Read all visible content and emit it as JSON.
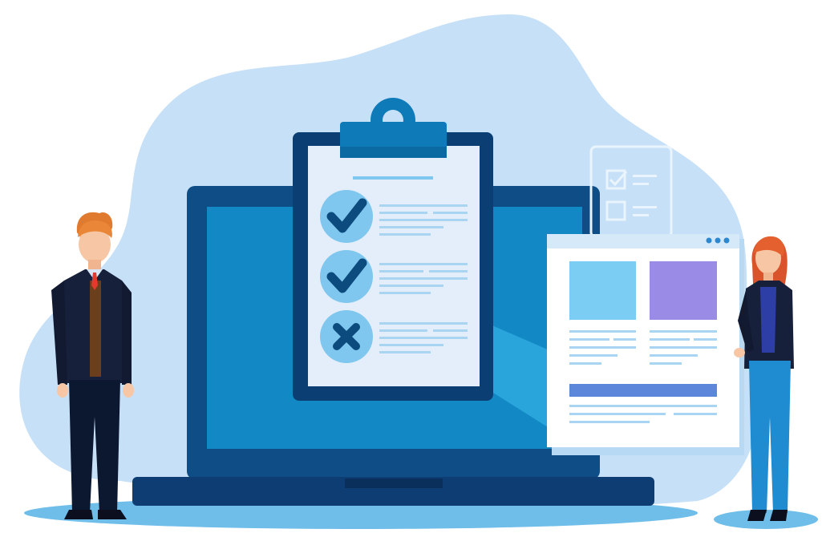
{
  "illustration": {
    "subject": "checklist-review-illustration",
    "checklist_items": [
      {
        "status": "checked",
        "icon": "check-icon"
      },
      {
        "status": "checked",
        "icon": "check-icon"
      },
      {
        "status": "rejected",
        "icon": "cross-icon"
      }
    ],
    "floating_task_card": [
      {
        "status": "checked",
        "icon": "checkbox-checked-icon"
      },
      {
        "status": "unchecked",
        "icon": "checkbox-empty-icon"
      }
    ],
    "colors": {
      "background_blob": "#c6e0f7",
      "laptop_frame": "#0e4d86",
      "laptop_screen": "#1289c4",
      "clipboard_frame": "#0b3f73",
      "clipboard_paper": "#e4eefa",
      "clipboard_clip": "#0f7ab8",
      "check_circle": "#7fc7ee",
      "check_mark": "#0b4b7d",
      "doc_panel": "#ffffff",
      "doc_tile_blue": "#7ccdf4",
      "doc_tile_purple": "#9a8be6",
      "doc_bar": "#5b86d9",
      "floor_shadow": "#6fbde9"
    }
  }
}
